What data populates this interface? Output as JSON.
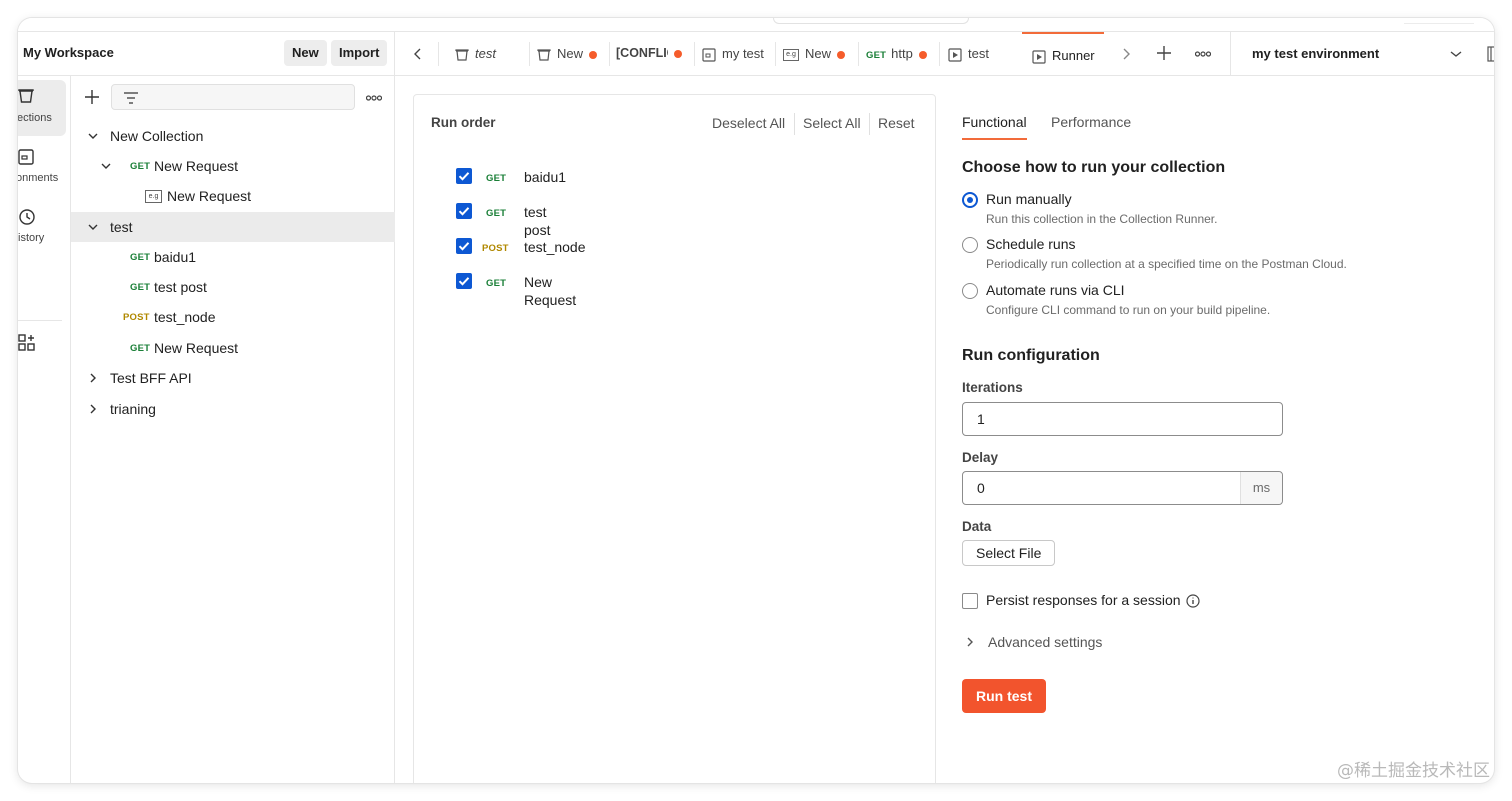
{
  "workspace": {
    "title": "My Workspace",
    "new_label": "New",
    "import_label": "Import"
  },
  "rail": [
    {
      "label": "ections",
      "icon": "collections-icon",
      "active": true
    },
    {
      "label": "onments",
      "icon": "environments-icon",
      "active": false
    },
    {
      "label": "istory",
      "icon": "history-icon",
      "active": false
    },
    {
      "label": "",
      "icon": "apps-icon",
      "active": false
    }
  ],
  "tree": {
    "items": [
      {
        "label": "New Collection",
        "method": "",
        "level": 0,
        "expanded": true
      },
      {
        "label": "New Request",
        "method": "GET",
        "level": 1,
        "expanded": true
      },
      {
        "label": "New Request",
        "method": "e.g",
        "level": 2,
        "expanded": false
      },
      {
        "label": "test",
        "method": "",
        "level": 0,
        "expanded": true,
        "selected": true
      },
      {
        "label": "baidu1",
        "method": "GET",
        "level": 1
      },
      {
        "label": "test post",
        "method": "GET",
        "level": 1
      },
      {
        "label": "test_node",
        "method": "POST",
        "level": 1
      },
      {
        "label": "New Request",
        "method": "GET",
        "level": 1
      },
      {
        "label": "Test BFF API",
        "method": "",
        "level": 0,
        "expanded": false
      },
      {
        "label": "trianing",
        "method": "",
        "level": 0,
        "expanded": false
      }
    ]
  },
  "tabs": [
    {
      "label": "test",
      "icon": "collection-icon",
      "dot": false,
      "italic": true
    },
    {
      "label": "New",
      "icon": "collection-icon",
      "dot": true
    },
    {
      "label": "[CONFLIC",
      "icon": "",
      "dot": true
    },
    {
      "label": "my test",
      "icon": "environment-icon",
      "dot": false
    },
    {
      "label": "New",
      "icon": "example-icon",
      "dot": true
    },
    {
      "label": "http",
      "method": "GET",
      "dot": true
    },
    {
      "label": "test",
      "icon": "runner-icon",
      "dot": false
    },
    {
      "label": "Runner",
      "icon": "runner-icon",
      "dot": false,
      "active": true
    }
  ],
  "environment": {
    "selected": "my test environment"
  },
  "run_order": {
    "title": "Run order",
    "deselect_all": "Deselect All",
    "select_all": "Select All",
    "reset": "Reset",
    "requests": [
      {
        "method": "GET",
        "name": "baidu1",
        "checked": true
      },
      {
        "method": "GET",
        "name": "test post",
        "checked": true
      },
      {
        "method": "POST",
        "name": "test_node",
        "checked": true
      },
      {
        "method": "GET",
        "name": "New Request",
        "checked": true
      }
    ]
  },
  "config": {
    "tabs": [
      "Functional",
      "Performance"
    ],
    "choose_title": "Choose how to run your collection",
    "options": [
      {
        "label": "Run manually",
        "desc": "Run this collection in the Collection Runner.",
        "selected": true
      },
      {
        "label": "Schedule runs",
        "desc": "Periodically run collection at a specified time on the Postman Cloud.",
        "selected": false
      },
      {
        "label": "Automate runs via CLI",
        "desc": "Configure CLI command to run on your build pipeline.",
        "selected": false
      }
    ],
    "run_config_title": "Run configuration",
    "iterations_label": "Iterations",
    "iterations_value": "1",
    "delay_label": "Delay",
    "delay_value": "0",
    "delay_unit": "ms",
    "data_label": "Data",
    "select_file": "Select File",
    "persist_label": "Persist responses for a session",
    "advanced_label": "Advanced settings",
    "run_button": "Run test"
  },
  "watermark": "@稀土掘金技术社区",
  "colors": {
    "accent": "#f2542d",
    "checkbox": "#0d58d3",
    "get": "#1a7f37",
    "post": "#b08800"
  }
}
